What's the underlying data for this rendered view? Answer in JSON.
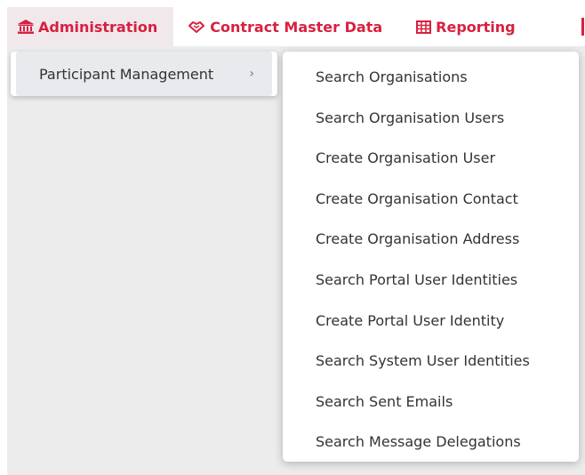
{
  "menubar": {
    "items": [
      {
        "label": "Administration",
        "icon": "bank-icon"
      },
      {
        "label": "Contract Master Data",
        "icon": "handshake-icon"
      },
      {
        "label": "Reporting",
        "icon": "table-icon"
      }
    ]
  },
  "submenu": {
    "label": "Participant Management",
    "chevron": "›"
  },
  "flyout": {
    "items": [
      "Search Organisations",
      "Search Organisation Users",
      "Create Organisation User",
      "Create Organisation Contact",
      "Create Organisation Address",
      "Search Portal User Identities",
      "Create Portal User Identity",
      "Search System User Identities",
      "Search Sent Emails",
      "Search Message Delegations"
    ]
  },
  "colors": {
    "accent": "#d8203f",
    "active_tab_bg": "#f1e8ec",
    "content_bg": "#ececec",
    "submenu_highlight": "#e8eaed"
  }
}
